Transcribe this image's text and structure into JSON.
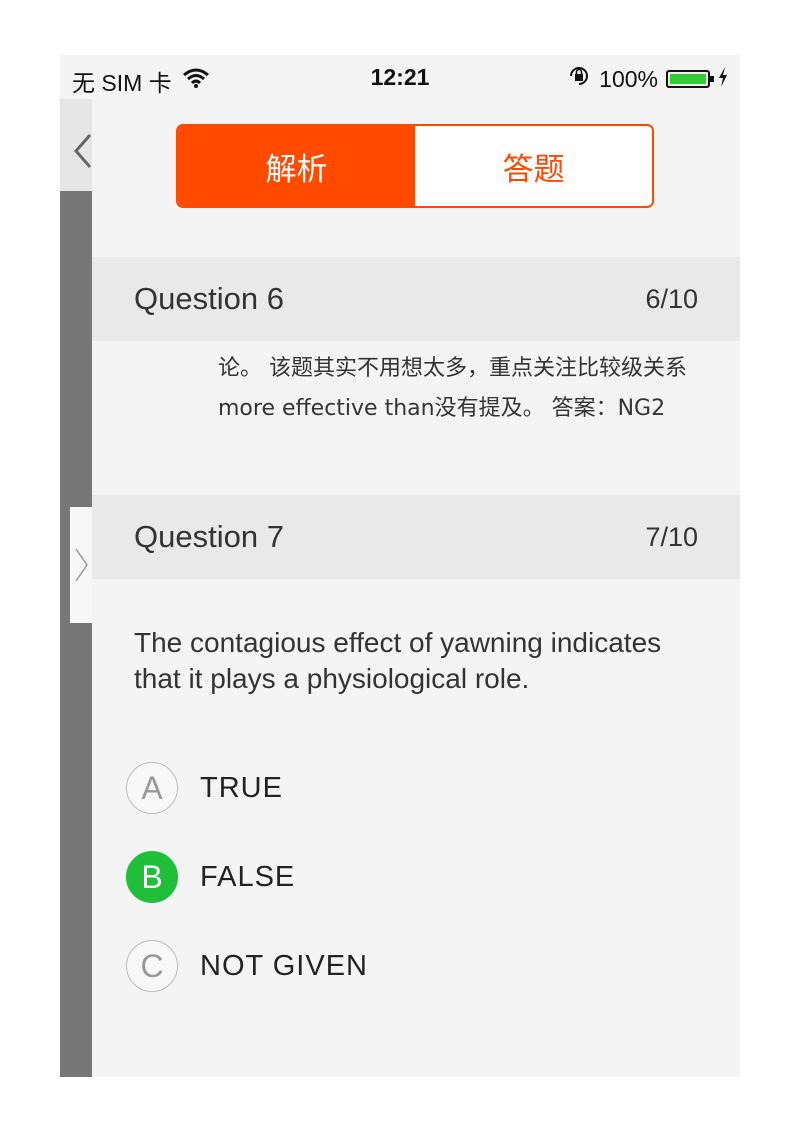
{
  "status_bar": {
    "carrier": "无 SIM 卡",
    "time": "12:21",
    "battery_percent": "100%",
    "battery_level": 1.0,
    "icons": [
      "wifi-icon",
      "orientation-lock-icon",
      "battery-icon",
      "charging-icon"
    ]
  },
  "segmented": {
    "analysis_label": "解析",
    "answer_label": "答题",
    "selected": "analysis"
  },
  "questions": [
    {
      "title": "Question 6",
      "count": "6/10",
      "analysis": "论。 该题其实不用想太多，重点关注比较级关系more effective than没有提及。 答案：NG2"
    },
    {
      "title": "Question 7",
      "count": "7/10",
      "text": "The contagious effect of yawning indicates that it plays a physiological role.",
      "options": [
        {
          "letter": "A",
          "label": "TRUE",
          "selected": false
        },
        {
          "letter": "B",
          "label": "FALSE",
          "selected": true
        },
        {
          "letter": "C",
          "label": "NOT GIVEN",
          "selected": false
        }
      ]
    }
  ],
  "colors": {
    "accent": "#ff4a00",
    "selected_option": "#1fbf3a",
    "background": "#f4f4f4",
    "header_band": "#e9e9e9"
  }
}
